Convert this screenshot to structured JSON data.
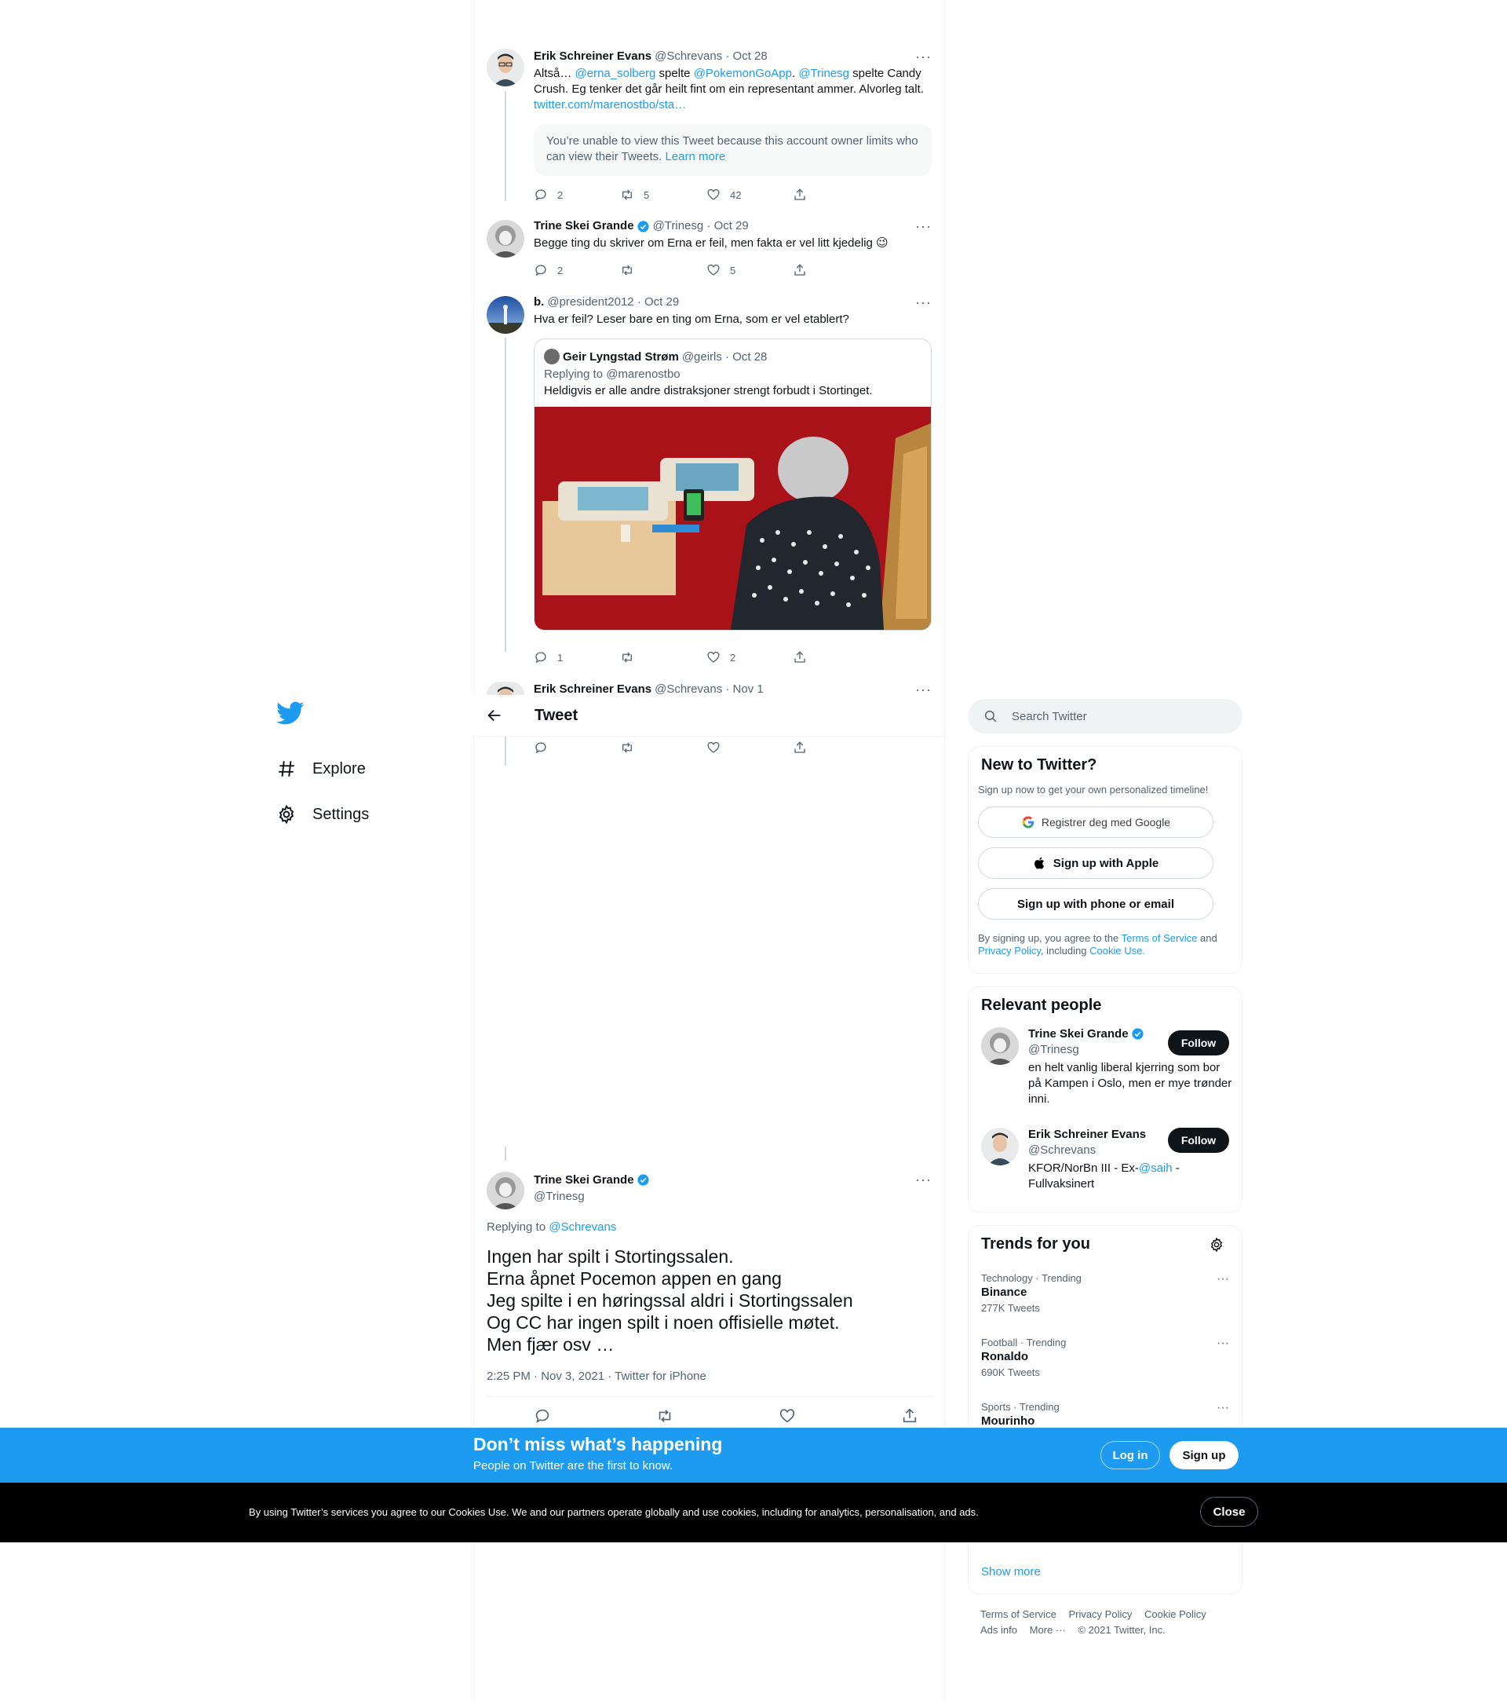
{
  "nav": {
    "items": [
      {
        "label": "Explore",
        "icon": "hashtag-icon"
      },
      {
        "label": "Settings",
        "icon": "gear-icon"
      }
    ]
  },
  "header": {
    "title": "Tweet"
  },
  "thread": [
    {
      "name": "Erik Schreiner Evans",
      "meta": "@Schrevans · Oct 28",
      "text_parts": [
        "Altså… ",
        "@erna_solberg",
        "  spelte ",
        "@PokemonGoApp",
        ". ",
        "@Trinesg",
        " spelte Candy Crush. Eg tenker det går heilt fint om ein representant ammer. Alvorleg talt. ",
        "twitter.com/marenostbo/sta…"
      ],
      "notice": "You’re unable to view this Tweet because this account owner limits who can view their Tweets.",
      "notice_link": "Learn more",
      "replies": "2",
      "retweets": "5",
      "likes": "42"
    },
    {
      "name": "Trine Skei Grande",
      "meta": "@Trinesg · Oct 29",
      "text": "Begge ting du skriver om Erna er feil, men fakta er vel litt kjedelig 😉",
      "replies": "2",
      "retweets": "",
      "likes": "5"
    },
    {
      "name": "b.",
      "meta": "@president2012 · Oct 29",
      "text": "Hva er feil? Leser bare en ting om Erna, som er vel etablert?",
      "quote": {
        "name": "Geir Lyngstad Strøm",
        "meta": "@geirls · Oct 28",
        "replying": "Replying to @marenostbo",
        "text": "Heldigvis er alle andre distraksjoner strengt forbudt i Stortinget."
      },
      "replies": "1",
      "retweets": "",
      "likes": "2"
    },
    {
      "name": "Erik Schreiner Evans",
      "meta": "@Schrevans · Nov 1"
    }
  ],
  "main_tweet": {
    "name": "Trine Skei Grande",
    "handle": "@Trinesg",
    "replying_label": "Replying to ",
    "replying_handle": "@Schrevans",
    "text": "Ingen har spilt i Stortingssalen.\nErna åpnet Pocemon appen en gang\nJeg spilte i en høringssal aldri i Stortingssalen\nOg CC har ingen spilt i noen offisielle møtet.\nMen fjær osv …",
    "time": "2:25 PM · Nov 3, 2021 · Twitter for iPhone"
  },
  "sidebar": {
    "search_placeholder": "Search Twitter",
    "new": {
      "title": "New to Twitter?",
      "subtitle": "Sign up now to get your own personalized timeline!",
      "google": "Registrer deg med Google",
      "apple": "Sign up with Apple",
      "phone": "Sign up with phone or email",
      "terms_1": "By signing up, you agree to the ",
      "terms_tos": "Terms of Service",
      "terms_2": " and ",
      "terms_privacy": "Privacy Policy",
      "terms_3": ", including ",
      "terms_cookie": "Cookie Use."
    },
    "people": {
      "title": "Relevant people",
      "follow_label": "Follow",
      "list": [
        {
          "name": "Trine Skei Grande",
          "handle": "@Trinesg",
          "bio": "en helt vanlig liberal kjerring som bor på Kampen i Oslo, men er mye trønder inni."
        },
        {
          "name": "Erik Schreiner Evans",
          "handle": "@Schrevans",
          "bio_1": "KFOR/NorBn III - Ex-",
          "bio_link": "@saih",
          "bio_2": " - Fullvaksinert"
        }
      ]
    },
    "trends": {
      "title": "Trends for you",
      "list": [
        {
          "category": "Technology · Trending",
          "name": "Binance",
          "count": "277K Tweets"
        },
        {
          "category": "Football · Trending",
          "name": "Ronaldo",
          "count": "690K Tweets"
        },
        {
          "category": "Sports · Trending",
          "name": "Mourinho",
          "count": ""
        }
      ],
      "show_more": "Show more"
    },
    "footer": {
      "links": [
        "Terms of Service",
        "Privacy Policy",
        "Cookie Policy",
        "Ads info",
        "More ···",
        "© 2021 Twitter, Inc."
      ]
    }
  },
  "banner": {
    "title": "Don’t miss what’s happening",
    "subtitle": "People on Twitter are the first to know.",
    "login": "Log in",
    "signup": "Sign up"
  },
  "cookie": {
    "text": "By using Twitter’s services you agree to our Cookies Use. We and our partners operate globally and use cookies, including for analytics, personalisation, and ads.",
    "close": "Close"
  },
  "colors": {
    "accent": "#1d9bf0",
    "text": "#0f1419",
    "secondary": "#536471",
    "cookie_bg": "#000000"
  }
}
